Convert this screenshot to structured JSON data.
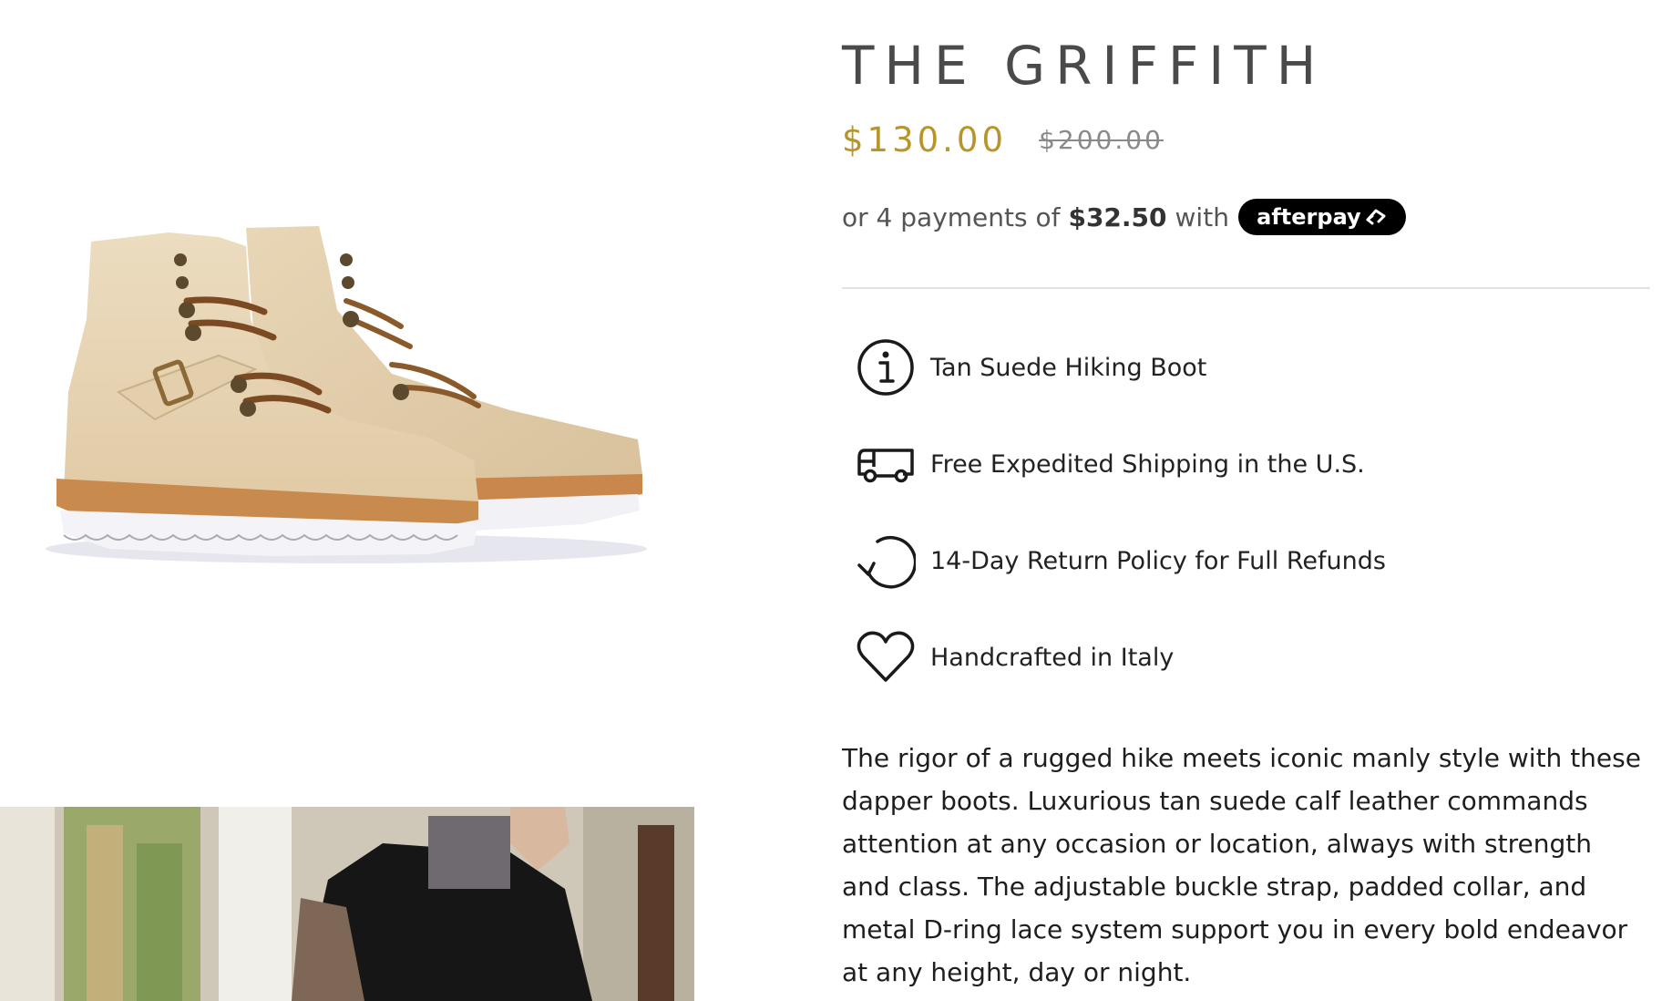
{
  "product": {
    "title": "THE GRIFFITH",
    "price_current": "$130.00",
    "price_original": "$200.00"
  },
  "afterpay": {
    "prefix": "or 4 payments of",
    "amount": "$32.50",
    "suffix": "with",
    "brand": "afterpay"
  },
  "features": [
    {
      "icon": "info-icon",
      "label": "Tan Suede Hiking Boot"
    },
    {
      "icon": "truck-icon",
      "label": "Free Expedited Shipping in the U.S."
    },
    {
      "icon": "return-icon",
      "label": "14-Day Return Policy for Full Refunds"
    },
    {
      "icon": "heart-icon",
      "label": "Handcrafted in Italy"
    }
  ],
  "description": "The rigor of a rugged hike meets iconic manly style with these dapper boots. Luxurious tan suede calf leather commands attention at any occasion or location, always with strength and class. The adjustable buckle strap, padded collar, and metal D-ring lace system support you in every bold endeavor at any height, day or night.",
  "colors": {
    "price_accent": "#b89529",
    "title": "#4a4a4a",
    "afterpay_badge": "#000000"
  }
}
